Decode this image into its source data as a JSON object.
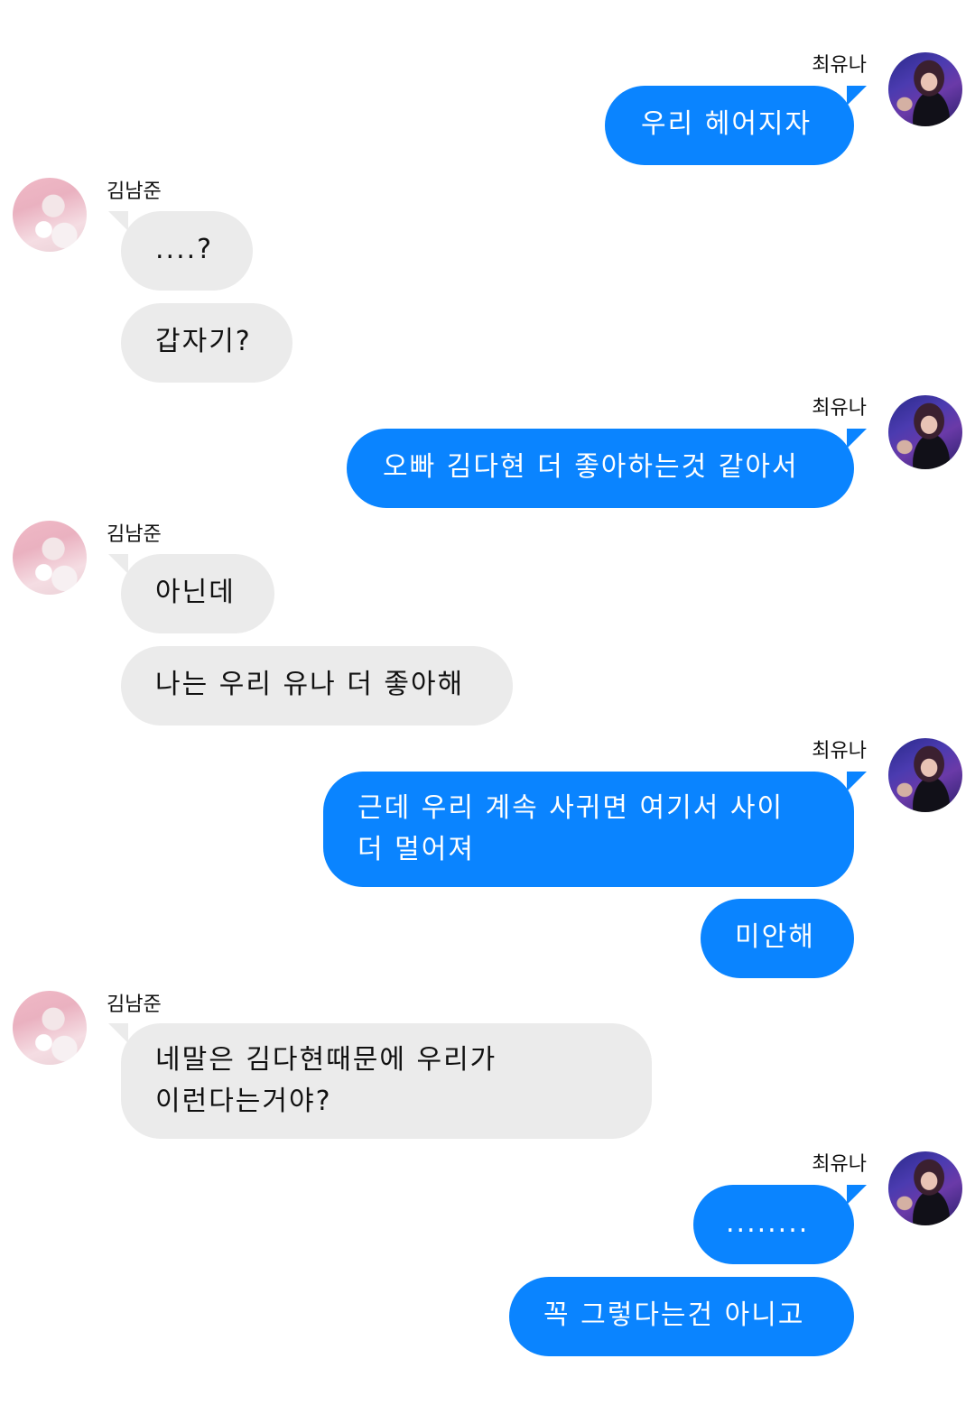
{
  "conversation": {
    "user_a": {
      "name": "김남준",
      "avatar_icon": "person-avatar-icon"
    },
    "user_b": {
      "name": "최유나",
      "avatar_icon": "person-avatar-icon"
    },
    "colors": {
      "outgoing_bubble": "#0a84ff",
      "incoming_bubble": "#ebebeb",
      "outgoing_text": "#ffffff",
      "incoming_text": "#111111"
    },
    "messages": [
      {
        "sender": "최유나",
        "text": "우리 헤어지자"
      },
      {
        "sender": "김남준",
        "text": "....?"
      },
      {
        "sender": "김남준",
        "text": "갑자기?"
      },
      {
        "sender": "최유나",
        "text": "오빠 김다현 더 좋아하는것 같아서"
      },
      {
        "sender": "김남준",
        "text": "아닌데"
      },
      {
        "sender": "김남준",
        "text": "나는 우리 유나 더 좋아해"
      },
      {
        "sender": "최유나",
        "text": "근데 우리 계속 사귀면 여기서 사이\n더 멀어져"
      },
      {
        "sender": "최유나",
        "text": "미안해"
      },
      {
        "sender": "김남준",
        "text": "네말은 김다현때문에 우리가\n이런다는거야?"
      },
      {
        "sender": "최유나",
        "text": "........"
      },
      {
        "sender": "최유나",
        "text": "꼭 그렇다는건 아니고"
      }
    ]
  }
}
